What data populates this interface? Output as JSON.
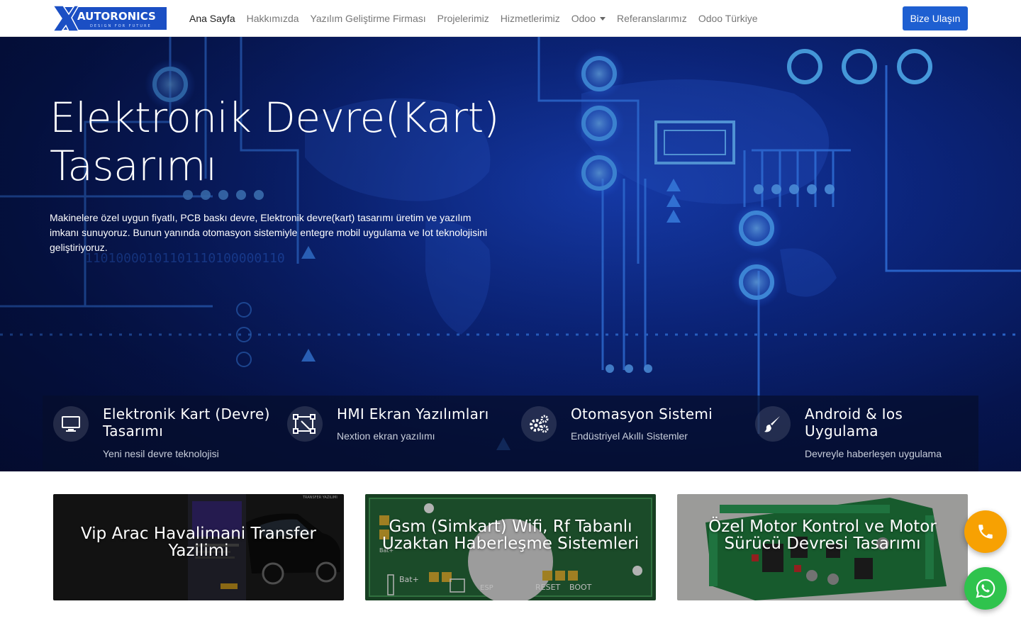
{
  "brand": {
    "logo_text": "AUTORONICS",
    "logo_tagline": "DESIGN FOR FUTURE",
    "accent_color": "#1e5fd1"
  },
  "nav": {
    "links": [
      {
        "label": "Ana Sayfa",
        "active": true
      },
      {
        "label": "Hakkımızda"
      },
      {
        "label": "Yazılım Geliştirme Firması"
      },
      {
        "label": "Projelerimiz"
      },
      {
        "label": "Hizmetlerimiz"
      },
      {
        "label": "Odoo",
        "dropdown": true
      },
      {
        "label": "Referanslarımız"
      },
      {
        "label": "Odoo Türkiye"
      }
    ],
    "cta_label": "Bize Ulaşın"
  },
  "hero": {
    "title": "Elektronik Devre(Kart) Tasarımı",
    "description": "Makinelere özel uygun fiyatlı, PCB baskı devre, Elektronik devre(kart) tasarımı üretim ve yazılım imkanı sunuyoruz. Bunun yanında otomasyon sistemiyle entegre mobil uygulama ve Iot teknolojisini geliştiriyoruz.",
    "background_digits": "11010000101101110100000110"
  },
  "features": [
    {
      "icon": "monitor-icon",
      "title": "Elektronik Kart (Devre) Tasarımı",
      "subtitle": "Yeni nesil devre teknolojisi"
    },
    {
      "icon": "vector-icon",
      "title": "HMI Ekran Yazılımları",
      "subtitle": "Nextion ekran yazılımı"
    },
    {
      "icon": "gears-icon",
      "title": "Otomasyon Sistemi",
      "subtitle": "Endüstriyel Akıllı Sistemler"
    },
    {
      "icon": "brush-icon",
      "title": "Android & Ios Uygulama",
      "subtitle": "Devreyle haberleşen uygulama"
    }
  ],
  "cards": [
    {
      "title": "Vip Arac Havalimani Transfer Yazilimi",
      "image_label": "TRANSFER YAZILIMI"
    },
    {
      "title": "Gsm (Simkart) Wifi, Rf Tabanlı Uzaktan Haberleşme Sistemleri",
      "pcb_labels": [
        "RESET",
        "BOOT",
        "Bat+",
        "Bat+",
        "ESP"
      ]
    },
    {
      "title": "Özel Motor Kontrol ve Motor Sürücü Devresi Tasarımı"
    }
  ],
  "floating": {
    "phone": {
      "icon": "phone-icon",
      "color": "#f7a102"
    },
    "whatsapp": {
      "icon": "whatsapp-icon",
      "color": "#2fc34d"
    }
  }
}
